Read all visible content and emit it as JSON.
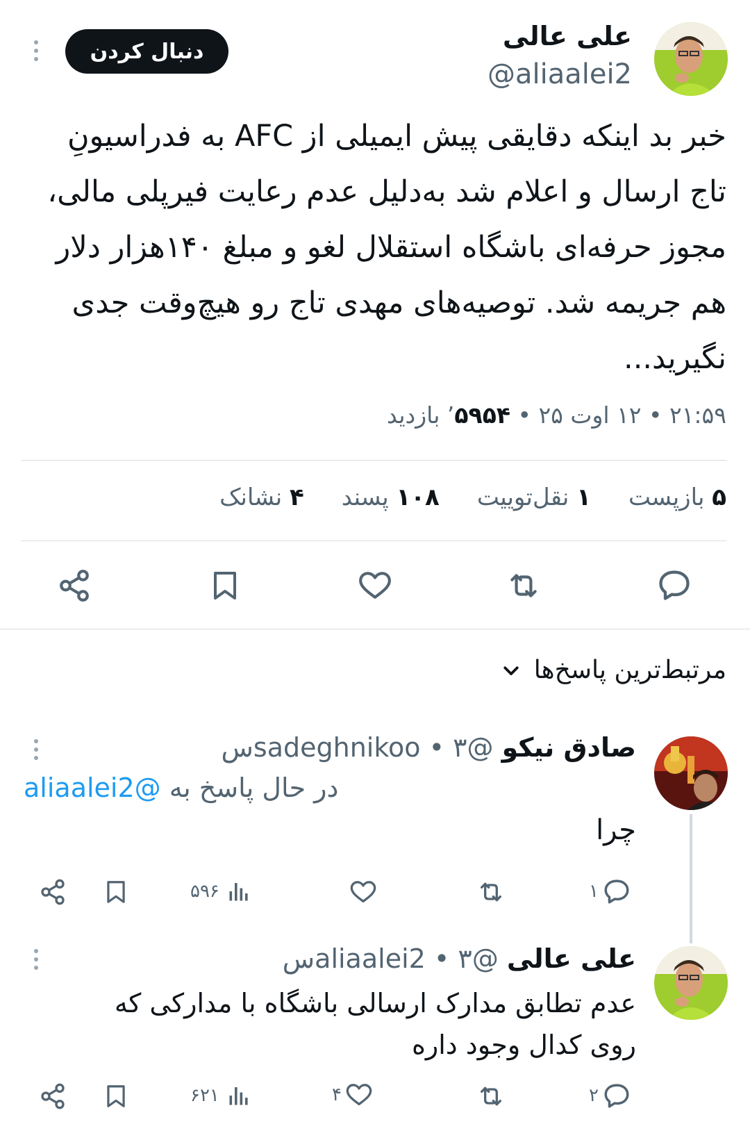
{
  "main_tweet": {
    "author_name": "علی عالی",
    "author_handle": "@aliaalei2",
    "follow_label": "دنبال کردن",
    "text": "خبر بد اینکه دقایقی پیش ایمیلی از AFC به فدراسیونِ تاج ارسال و اعلام شد به‌دلیل عدم رعایت فیرپلی مالی، مجوز حرفه‌ای باشگاه استقلال لغو و مبلغ ۱۴۰هزار  دلار هم جریمه شد. توصیه‌های مهدی تاج رو هیچ‌وقت جدی نگیرید...",
    "timestamp": "۲۱:۵۹ • ۱۲ اوت ۲۵ •",
    "views_count": "۵۹۵۴",
    "views_label": "’ بازدید",
    "stats": {
      "reposts_count": "۵",
      "reposts_label": "بازپست",
      "quotes_count": "۱",
      "quotes_label": "نقل‌توییت",
      "likes_count": "۱۰۸",
      "likes_label": "پسند",
      "bookmarks_count": "۴",
      "bookmarks_label": "نشانک"
    }
  },
  "replies_sort_label": "مرتبط‌ترین پاسخ‌ها",
  "replies": [
    {
      "author_name": "صادق نیکو",
      "author_handle": "@sadeghnikoo",
      "time": "• ۳س",
      "replying_to_label": "در حال پاسخ به",
      "replying_to_handle": "@aliaalei2",
      "text": "چرا",
      "reply_count": "۱",
      "retweet_count": "",
      "like_count": "",
      "views_count": "۵۹۶"
    },
    {
      "author_name": "علی عالی",
      "author_handle": "@aliaalei2",
      "time": "• ۳س",
      "text": "عدم تطابق مدارک ارسالی باشگاه با مدارکی که روی کدال وجود داره",
      "reply_count": "۲",
      "retweet_count": "",
      "like_count": "۴",
      "views_count": "۶۲۱"
    }
  ],
  "icons": {
    "reply": "reply-icon",
    "retweet": "retweet-icon",
    "like": "heart-icon",
    "bookmark": "bookmark-icon",
    "share": "share-icon",
    "views": "views-icon",
    "more": "more-icon",
    "chevron": "chevron-down-icon"
  },
  "colors": {
    "text": "#0f1419",
    "muted": "#536471",
    "link": "#1d9bf0",
    "follow_bg": "#0f1419"
  }
}
